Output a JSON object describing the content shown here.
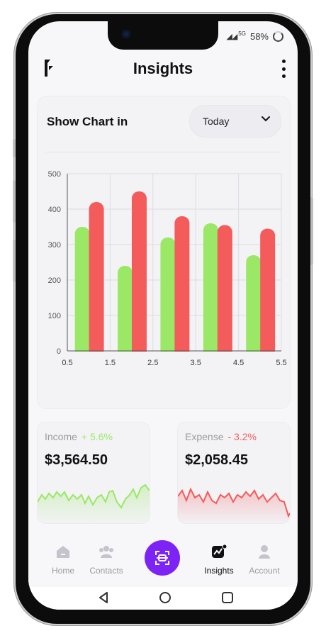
{
  "status": {
    "signal": "5G",
    "battery": "58%"
  },
  "header": {
    "title": "Insights"
  },
  "chart_card": {
    "label": "Show Chart in",
    "period": "Today"
  },
  "chart_data": {
    "type": "bar",
    "x_ticks": [
      "0.5",
      "1.5",
      "2.5",
      "3.5",
      "4.5",
      "5.5"
    ],
    "y_ticks": [
      "0",
      "100",
      "200",
      "300",
      "400",
      "500"
    ],
    "xlim": [
      0.5,
      5.5
    ],
    "ylim": [
      0,
      500
    ],
    "grid": true,
    "series": [
      {
        "color": "#9ae866",
        "x": [
          0.85,
          1.85,
          2.85,
          3.85,
          4.85
        ],
        "values": [
          350,
          240,
          320,
          360,
          270
        ]
      },
      {
        "color": "#f45b5b",
        "x": [
          1.18,
          2.18,
          3.18,
          4.18,
          5.18
        ],
        "values": [
          420,
          450,
          380,
          355,
          345
        ]
      }
    ]
  },
  "income": {
    "label": "Income",
    "change": "+ 5.6%",
    "amount": "$3,564.50",
    "color": "#9ae866"
  },
  "expense": {
    "label": "Expense",
    "change": "- 3.2%",
    "amount": "$2,058.45",
    "color": "#f45b5b"
  },
  "nav": {
    "home": "Home",
    "contacts": "Contacts",
    "insights": "Insights",
    "account": "Account",
    "active": "insights"
  }
}
